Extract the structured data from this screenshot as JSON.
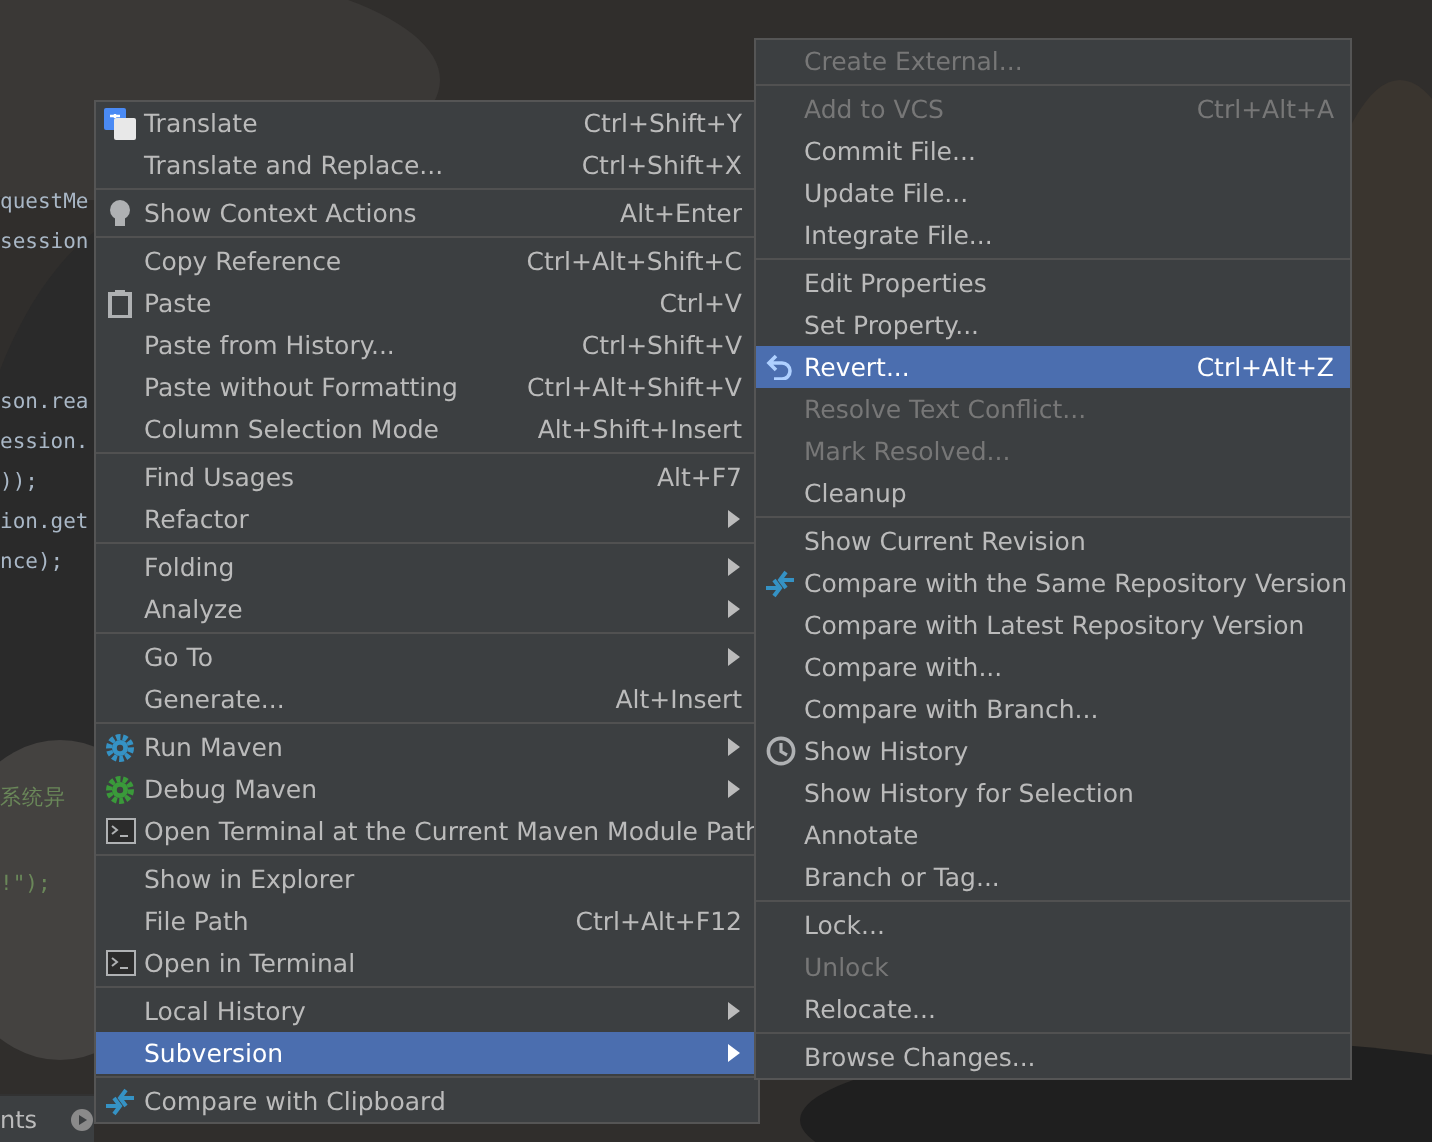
{
  "editor": {
    "lines": [
      {
        "text": "questMe",
        "kind": "code"
      },
      {
        "text": "session",
        "kind": "code"
      },
      {
        "text": "son.rea",
        "kind": "code"
      },
      {
        "text": "ession.",
        "kind": "code"
      },
      {
        "text": "));",
        "kind": "code"
      },
      {
        "text": "ion.get",
        "kind": "code"
      },
      {
        "text": "nce);",
        "kind": "code"
      },
      {
        "text": "系统异",
        "kind": "string"
      },
      {
        "text": "!\");",
        "kind": "string"
      }
    ],
    "tool_tab": "nts"
  },
  "menus": [
    {
      "items": [
        {
          "kind": "item",
          "label": "Translate",
          "shortcut": "Ctrl+Shift+Y",
          "selected": false
        },
        {
          "kind": "item",
          "label": "Translate and Replace...",
          "shortcut": "Ctrl+Shift+X",
          "selected": false
        },
        {
          "kind": "separator"
        },
        {
          "kind": "item",
          "label": "Show Context Actions",
          "shortcut": "Alt+Enter",
          "selected": false
        },
        {
          "kind": "separator"
        },
        {
          "kind": "item",
          "label": "Copy Reference",
          "shortcut": "Ctrl+Alt+Shift+C",
          "selected": false
        },
        {
          "kind": "item",
          "label": "Paste",
          "shortcut": "Ctrl+V",
          "selected": false
        },
        {
          "kind": "item",
          "label": "Paste from History...",
          "shortcut": "Ctrl+Shift+V",
          "selected": false
        },
        {
          "kind": "item",
          "label": "Paste without Formatting",
          "shortcut": "Ctrl+Alt+Shift+V",
          "selected": false
        },
        {
          "kind": "item",
          "label": "Column Selection Mode",
          "shortcut": "Alt+Shift+Insert",
          "selected": false
        },
        {
          "kind": "separator"
        },
        {
          "kind": "item",
          "label": "Find Usages",
          "shortcut": "Alt+F7",
          "selected": false
        },
        {
          "kind": "submenu",
          "label": "Refactor",
          "selected": false
        },
        {
          "kind": "separator"
        },
        {
          "kind": "submenu",
          "label": "Folding",
          "selected": false
        },
        {
          "kind": "submenu",
          "label": "Analyze",
          "selected": false
        },
        {
          "kind": "separator"
        },
        {
          "kind": "submenu",
          "label": "Go To",
          "selected": false
        },
        {
          "kind": "item",
          "label": "Generate...",
          "shortcut": "Alt+Insert",
          "selected": false
        },
        {
          "kind": "separator"
        },
        {
          "kind": "submenu",
          "label": "Run Maven",
          "selected": false
        },
        {
          "kind": "submenu",
          "label": "Debug Maven",
          "selected": false
        },
        {
          "kind": "item",
          "label": "Open Terminal at the Current Maven Module Path",
          "selected": false
        },
        {
          "kind": "separator"
        },
        {
          "kind": "item",
          "label": "Show in Explorer",
          "selected": false
        },
        {
          "kind": "item",
          "label": "File Path",
          "shortcut": "Ctrl+Alt+F12",
          "selected": false
        },
        {
          "kind": "item",
          "label": "Open in Terminal",
          "selected": false
        },
        {
          "kind": "separator"
        },
        {
          "kind": "submenu",
          "label": "Local History",
          "selected": false
        },
        {
          "kind": "submenu",
          "label": "Subversion",
          "selected": true
        },
        {
          "kind": "separator"
        },
        {
          "kind": "item",
          "label": "Compare with Clipboard",
          "selected": false
        }
      ]
    },
    {
      "items": [
        {
          "kind": "item",
          "label": "Create External...",
          "disabled": true,
          "selected": false
        },
        {
          "kind": "separator"
        },
        {
          "kind": "item",
          "label": "Add to VCS",
          "shortcut": "Ctrl+Alt+A",
          "disabled": true,
          "selected": false
        },
        {
          "kind": "item",
          "label": "Commit File...",
          "disabled": false,
          "selected": false
        },
        {
          "kind": "item",
          "label": "Update File...",
          "disabled": false,
          "selected": false
        },
        {
          "kind": "item",
          "label": "Integrate File...",
          "disabled": false,
          "selected": false
        },
        {
          "kind": "separator"
        },
        {
          "kind": "item",
          "label": "Edit Properties",
          "disabled": false,
          "selected": false
        },
        {
          "kind": "item",
          "label": "Set Property...",
          "disabled": false,
          "selected": false
        },
        {
          "kind": "item",
          "label": "Revert...",
          "shortcut": "Ctrl+Alt+Z",
          "disabled": false,
          "selected": true
        },
        {
          "kind": "item",
          "label": "Resolve Text Conflict...",
          "disabled": true,
          "selected": false
        },
        {
          "kind": "item",
          "label": "Mark Resolved...",
          "disabled": true,
          "selected": false
        },
        {
          "kind": "item",
          "label": "Cleanup",
          "disabled": false,
          "selected": false
        },
        {
          "kind": "separator"
        },
        {
          "kind": "item",
          "label": "Show Current Revision",
          "disabled": false,
          "selected": false
        },
        {
          "kind": "item",
          "label": "Compare with the Same Repository Version",
          "disabled": false,
          "selected": false
        },
        {
          "kind": "item",
          "label": "Compare with Latest Repository Version",
          "disabled": false,
          "selected": false
        },
        {
          "kind": "item",
          "label": "Compare with...",
          "disabled": false,
          "selected": false
        },
        {
          "kind": "item",
          "label": "Compare with Branch...",
          "disabled": false,
          "selected": false
        },
        {
          "kind": "item",
          "label": "Show History",
          "disabled": false,
          "selected": false
        },
        {
          "kind": "item",
          "label": "Show History for Selection",
          "disabled": false,
          "selected": false
        },
        {
          "kind": "item",
          "label": "Annotate",
          "disabled": false,
          "selected": false
        },
        {
          "kind": "item",
          "label": "Branch or Tag...",
          "disabled": false,
          "selected": false
        },
        {
          "kind": "separator"
        },
        {
          "kind": "item",
          "label": "Lock...",
          "disabled": false,
          "selected": false
        },
        {
          "kind": "item",
          "label": "Unlock",
          "disabled": true,
          "selected": false
        },
        {
          "kind": "item",
          "label": "Relocate...",
          "disabled": false,
          "selected": false
        },
        {
          "kind": "separator"
        },
        {
          "kind": "item",
          "label": "Browse Changes...",
          "disabled": false,
          "selected": false
        }
      ]
    }
  ]
}
